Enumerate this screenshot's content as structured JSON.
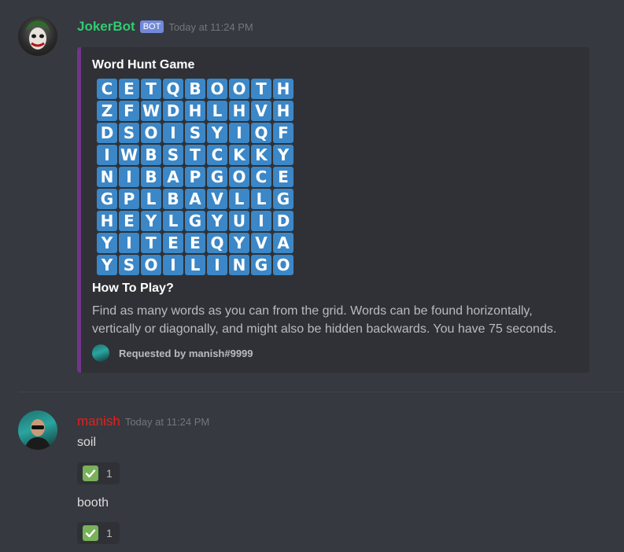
{
  "messages": {
    "bot": {
      "username": "JokerBot",
      "tag": "BOT",
      "timestamp": "Today at 11:24 PM",
      "avatar_icon": "joker-avatar-icon",
      "embed": {
        "accent_color": "#71368a",
        "title": "Word Hunt Game",
        "grid": [
          [
            "C",
            "E",
            "T",
            "Q",
            "B",
            "O",
            "O",
            "T",
            "H"
          ],
          [
            "Z",
            "F",
            "W",
            "D",
            "H",
            "L",
            "H",
            "V",
            "H"
          ],
          [
            "D",
            "S",
            "O",
            "I",
            "S",
            "Y",
            "I",
            "Q",
            "F"
          ],
          [
            "I",
            "W",
            "B",
            "S",
            "T",
            "C",
            "K",
            "K",
            "Y"
          ],
          [
            "N",
            "I",
            "B",
            "A",
            "P",
            "G",
            "O",
            "C",
            "E"
          ],
          [
            "G",
            "P",
            "L",
            "B",
            "A",
            "V",
            "L",
            "L",
            "G"
          ],
          [
            "H",
            "E",
            "Y",
            "L",
            "G",
            "Y",
            "U",
            "I",
            "D"
          ],
          [
            "Y",
            "I",
            "T",
            "E",
            "E",
            "Q",
            "Y",
            "V",
            "A"
          ],
          [
            "Y",
            "S",
            "O",
            "I",
            "L",
            "I",
            "N",
            "G",
            "O"
          ]
        ],
        "field_name": "How To Play?",
        "field_value": "Find as many words as you can from the grid. Words can be found horizontally, vertically or diagonally, and might also be hidden backwards. You have 75 seconds.",
        "footer_text": "Requested by manish#9999"
      }
    },
    "user": {
      "username": "manish",
      "timestamp": "Today at 11:24 PM",
      "lines": [
        {
          "text": "soil",
          "reaction": {
            "emoji": "white-check-mark-icon",
            "count": "1"
          }
        },
        {
          "text": "booth",
          "reaction": {
            "emoji": "white-check-mark-icon",
            "count": "1"
          }
        }
      ]
    }
  },
  "colors": {
    "background": "#36393f",
    "bot_name": "#2ecc71",
    "user_name": "#e3211e",
    "grid_cell": "#3b87c7",
    "check": "#78b159"
  }
}
